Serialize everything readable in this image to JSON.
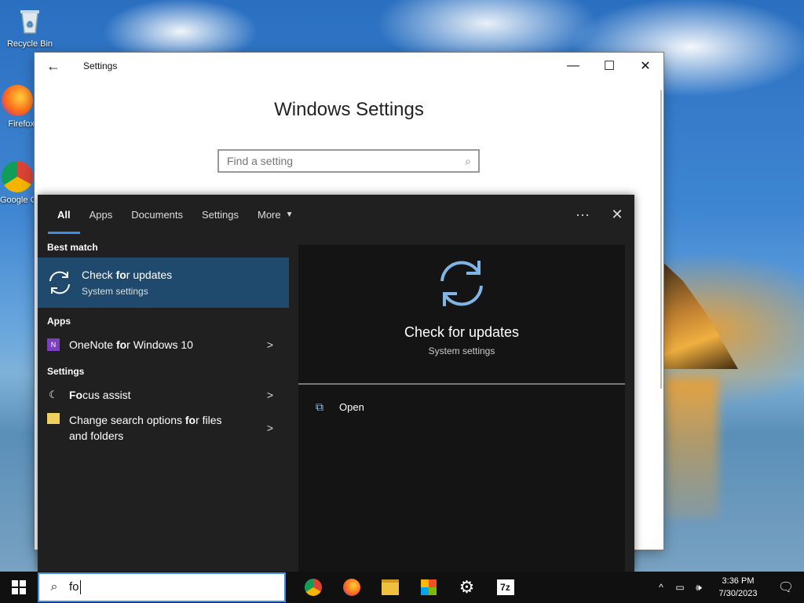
{
  "desktop": {
    "icons": [
      {
        "label": "Recycle Bin"
      },
      {
        "label": "Firefox"
      },
      {
        "label": "Google Chrome"
      }
    ]
  },
  "settings_window": {
    "title": "Settings",
    "heading": "Windows Settings",
    "search_placeholder": "Find a setting",
    "buttons": {
      "minimize": "—",
      "maximize": "☐",
      "close": "✕",
      "back": "←"
    }
  },
  "search_panel": {
    "tabs": [
      {
        "label": "All",
        "active": true
      },
      {
        "label": "Apps"
      },
      {
        "label": "Documents"
      },
      {
        "label": "Settings"
      },
      {
        "label": "More"
      }
    ],
    "ellipsis": "···",
    "close": "✕",
    "best_match_header": "Best match",
    "best_match": {
      "title_pre": "Check ",
      "title_bold": "fo",
      "title_post": "r updates",
      "subtitle": "System settings"
    },
    "apps_header": "Apps",
    "apps": [
      {
        "pre": "OneNote ",
        "bold": "fo",
        "post": "r Windows 10"
      }
    ],
    "settings_header": "Settings",
    "settings": [
      {
        "pre": "",
        "bold": "Fo",
        "post": "cus assist"
      },
      {
        "pre": "Change search options ",
        "bold": "fo",
        "post": "r files and folders"
      }
    ],
    "preview": {
      "title": "Check for updates",
      "subtitle": "System settings",
      "action": "Open"
    }
  },
  "taskbar": {
    "search_text": "fo",
    "time": "3:36 PM",
    "date": "7/30/2023"
  },
  "colors": {
    "accent": "#3a8ee6",
    "highlight": "#1f4a6e",
    "panel": "#202020"
  }
}
